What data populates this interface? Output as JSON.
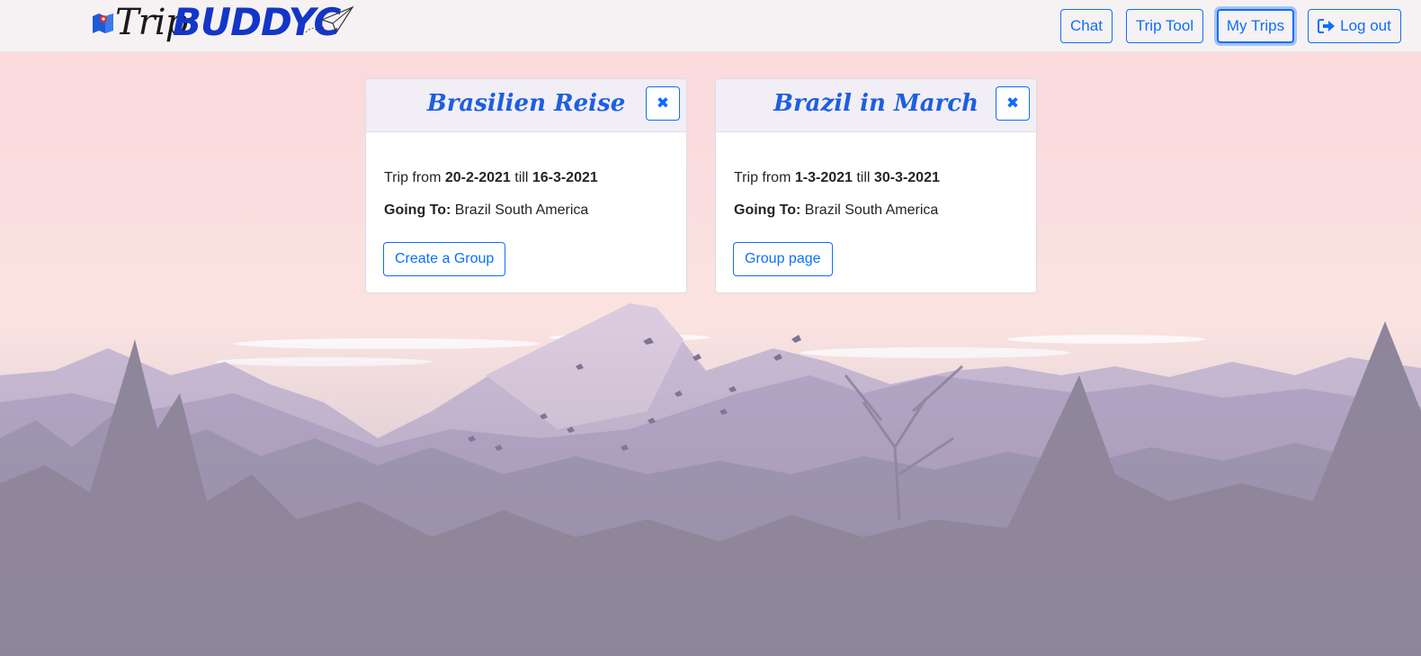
{
  "brand": {
    "part1": "Trip",
    "part2": "BUDDYC"
  },
  "nav": {
    "chat": "Chat",
    "trip_tool": "Trip Tool",
    "my_trips": "My Trips",
    "logout": "Log out",
    "active": "my_trips"
  },
  "colors": {
    "accent": "#0d6efd",
    "brand_blue": "#1336c8",
    "title_blue": "#1d5fe0"
  },
  "trips": [
    {
      "title": "Brasilien Reise",
      "close_label": "✖",
      "from_prefix": "Trip from",
      "start": "20-2-2021",
      "till": "till",
      "end": "16-3-2021",
      "going_label": "Going To:",
      "destination": "Brazil South America",
      "action_label": "Create a Group"
    },
    {
      "title": "Brazil in March",
      "close_label": "✖",
      "from_prefix": "Trip from",
      "start": "1-3-2021",
      "till": "till",
      "end": "30-3-2021",
      "going_label": "Going To:",
      "destination": "Brazil South America",
      "action_label": "Group page"
    }
  ]
}
